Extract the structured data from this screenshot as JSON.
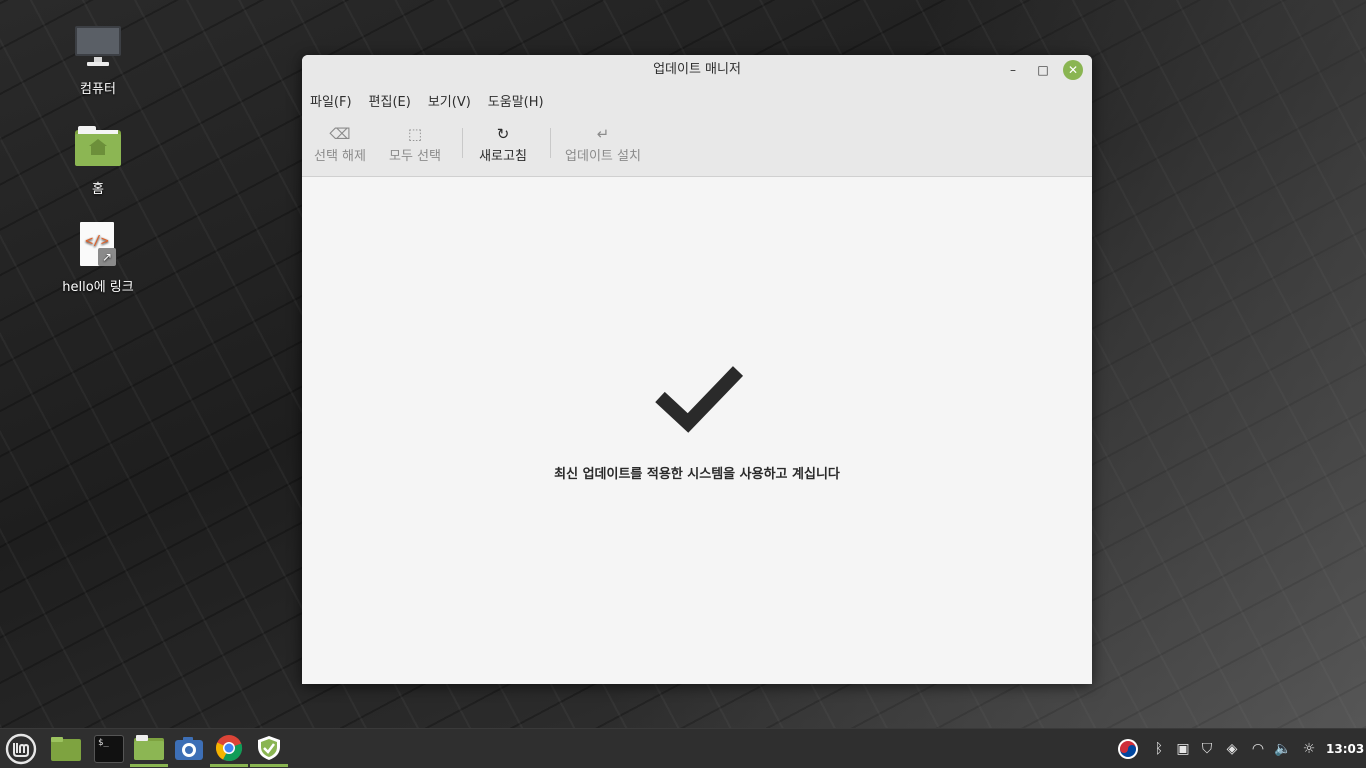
{
  "desktop": {
    "icons": [
      {
        "label": "컴퓨터",
        "icon": "monitor-icon"
      },
      {
        "label": "홈",
        "icon": "home-folder-icon"
      },
      {
        "label": "hello에 링크",
        "icon": "html-file-link-icon",
        "code": "</>",
        "arrow": "↗"
      }
    ]
  },
  "window": {
    "title": "업데이트 매니저",
    "buttons": {
      "minimize": "–",
      "maximize": "□",
      "close": "✕"
    },
    "menu": [
      "파일(F)",
      "편집(E)",
      "보기(V)",
      "도움말(H)"
    ],
    "toolbar": [
      {
        "label": "선택 해제",
        "icon": "clear-selection-icon",
        "glyph": "⌫",
        "enabled": false
      },
      {
        "label": "모두 선택",
        "icon": "select-all-icon",
        "glyph": "⬚",
        "enabled": false
      },
      {
        "label": "새로고침",
        "icon": "refresh-icon",
        "glyph": "↻",
        "enabled": true
      },
      {
        "label": "업데이트 설치",
        "icon": "install-updates-icon",
        "glyph": "↵",
        "enabled": false
      }
    ],
    "status_message": "최신 업데이트를 적용한 시스템을 사용하고 계십니다"
  },
  "taskbar": {
    "apps": [
      {
        "name": "mint-menu-icon"
      },
      {
        "name": "show-desktop-icon"
      },
      {
        "name": "terminal-icon",
        "glyph": "$_"
      },
      {
        "name": "file-manager-icon"
      },
      {
        "name": "screenshot-icon"
      },
      {
        "name": "chrome-icon"
      },
      {
        "name": "update-manager-icon"
      }
    ],
    "tray": [
      {
        "name": "input-method-icon"
      },
      {
        "name": "bluetooth-icon",
        "glyph": "ᛒ"
      },
      {
        "name": "clipboard-icon",
        "glyph": "▣"
      },
      {
        "name": "shield-icon",
        "glyph": "⛉"
      },
      {
        "name": "nvidia-icon",
        "glyph": "◈"
      },
      {
        "name": "wifi-icon",
        "glyph": "◠"
      },
      {
        "name": "volume-icon",
        "glyph": "🔈"
      },
      {
        "name": "brightness-icon",
        "glyph": "☼"
      }
    ],
    "clock": "13:03"
  },
  "colors": {
    "accent": "#8ab552",
    "panel": "#2f2f2f",
    "window_bg": "#f5f5f5",
    "header_bg": "#e8e8e8"
  }
}
